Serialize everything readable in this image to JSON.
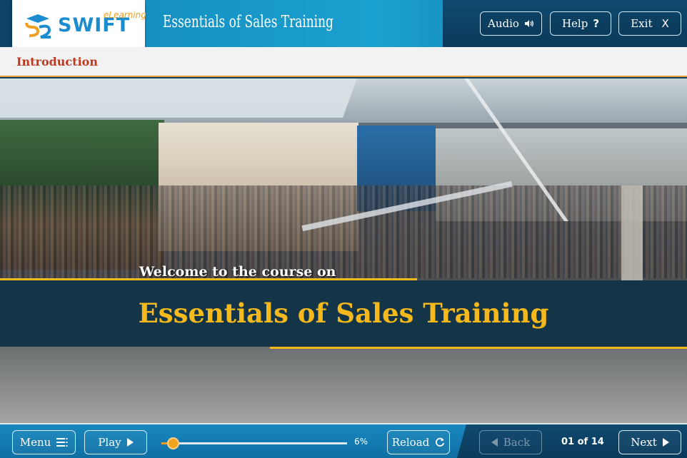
{
  "logo": {
    "wordmark": "SWIFT",
    "tagline": "eLearning",
    "brand_color": "#1a8ccf",
    "accent_color": "#f0a020"
  },
  "header": {
    "course_title": "Essentials of Sales Training",
    "audio_label": "Audio",
    "audio_icon": "speaker-icon",
    "help_label": "Help",
    "help_icon": "question-icon",
    "exit_label": "Exit",
    "exit_icon": "close-icon"
  },
  "section": {
    "title": "Introduction"
  },
  "slide": {
    "welcome_text": "Welcome to the course on",
    "title": "Essentials of Sales Training",
    "title_color": "#f5b91c",
    "background_image": "shopping-mall-crowd"
  },
  "footer": {
    "menu_label": "Menu",
    "menu_icon": "hamburger-icon",
    "play_label": "Play",
    "play_icon": "play-triangle-icon",
    "progress_percent": 6,
    "progress_text": "6%",
    "reload_label": "Reload",
    "reload_icon": "reload-icon",
    "back_label": "Back",
    "back_icon": "back-triangle-icon",
    "page_counter": "01 of 14",
    "next_label": "Next",
    "next_icon": "next-triangle-icon"
  }
}
